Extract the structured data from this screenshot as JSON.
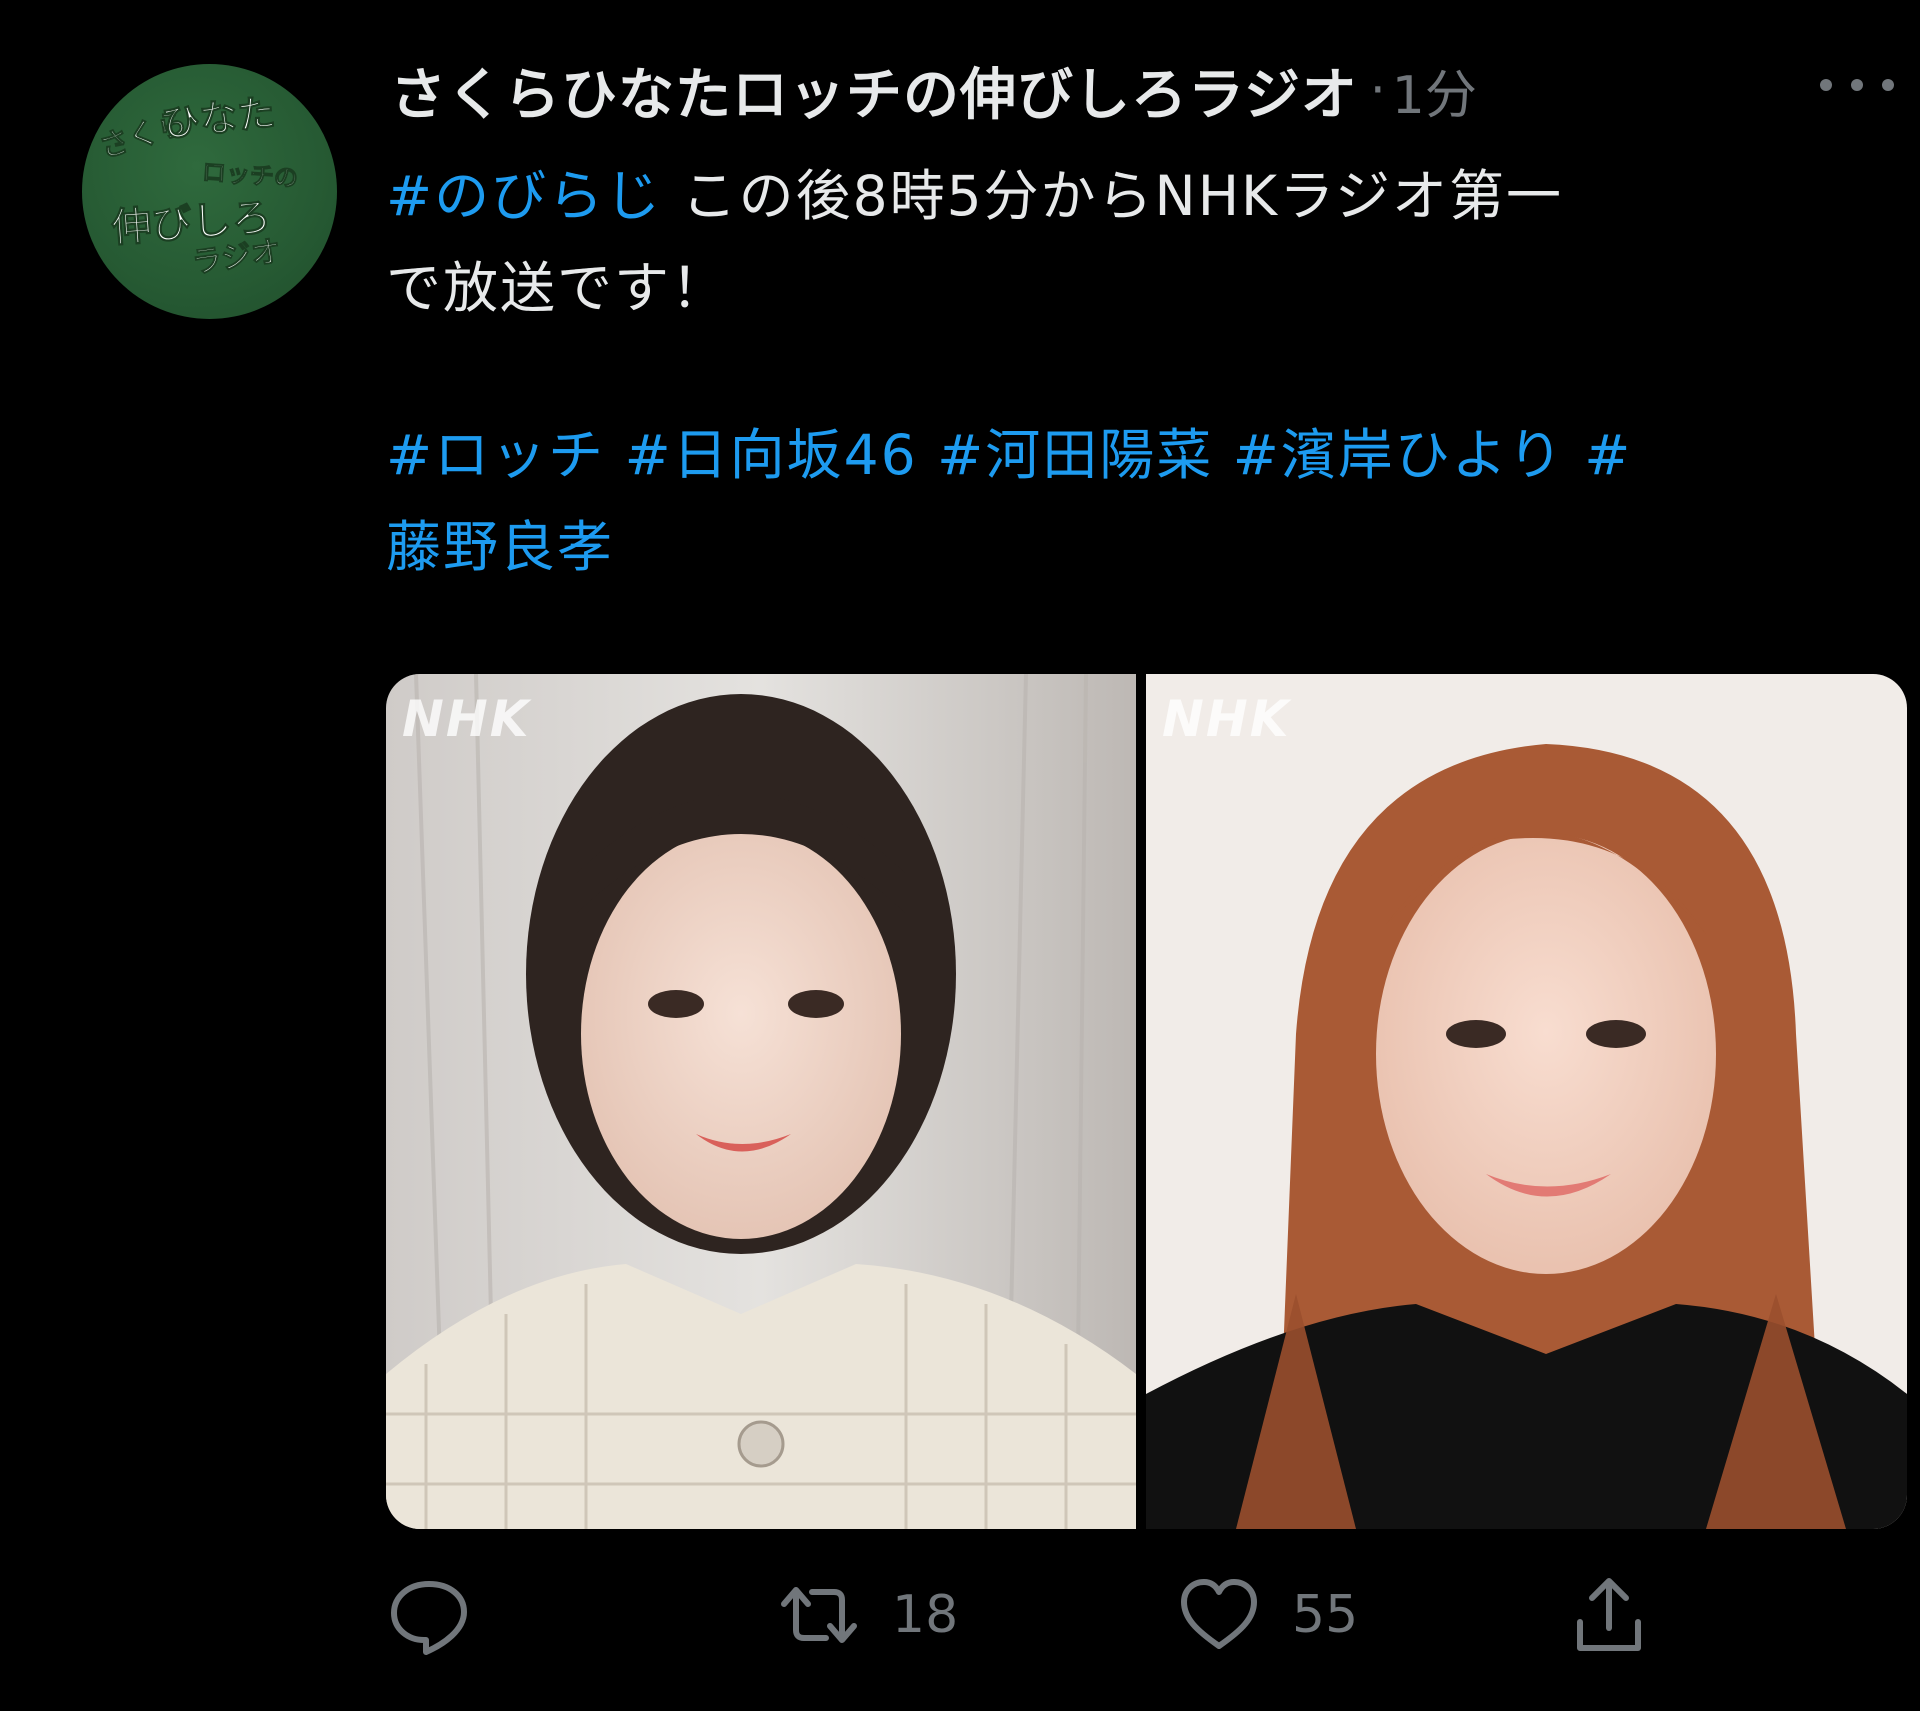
{
  "tweet": {
    "author": "さくらひなたロッチの伸びしろラジオ",
    "separator": "·",
    "time": "1分",
    "avatar": {
      "lines": [
        "さくら",
        "ひなた",
        "ロッチの",
        "伸びしろ",
        "ラジオ"
      ]
    },
    "text": {
      "line1_tag": "#のびらじ",
      "line1_text": " この後8時5分からNHKラジオ第一",
      "line2_text": "で放送です！",
      "hashtags": [
        "#ロッチ",
        "#日向坂46",
        "#河田陽菜",
        "#濱岸ひより",
        "#"
      ],
      "hashtag_cont": "藤野良孝"
    },
    "media": {
      "watermark": "NHK"
    },
    "actions": {
      "reply_count": "",
      "retweet_count": "18",
      "like_count": "55"
    }
  },
  "colors": {
    "background": "#000000",
    "text": "#e7e9ea",
    "muted": "#71767b",
    "link": "#1d9bf0",
    "avatar_green": "#265a33"
  },
  "icons": [
    "more-icon",
    "reply-icon",
    "retweet-icon",
    "like-icon",
    "share-icon"
  ]
}
